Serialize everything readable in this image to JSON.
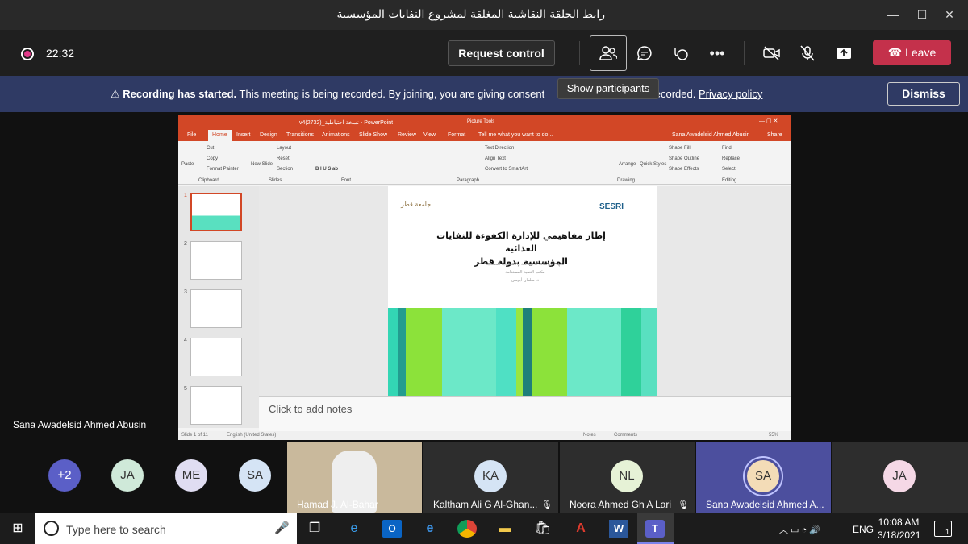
{
  "window": {
    "title": "رابط الحلقة النقاشية المغلقة لمشروع النفايات المؤسسية"
  },
  "topbar": {
    "timer": "22:32",
    "request_control": "Request control",
    "leave": "Leave"
  },
  "tooltip": "Show participants",
  "banner": {
    "bold": "Recording has started.",
    "text_a": " This meeting is being recorded. By joining, you are giving consent ",
    "text_b": " recorded. ",
    "link": "Privacy policy",
    "dismiss": "Dismiss"
  },
  "presenter_name": "Sana Awadelsid Ahmed Abusin",
  "ppt": {
    "titlebar": "v4(2732)_نسخة احتياطية - PowerPoint",
    "picture_tools": "Picture Tools",
    "user": "Sana Awadelsid Ahmed Abusin",
    "share": "Share",
    "tabs": [
      "File",
      "Home",
      "Insert",
      "Design",
      "Transitions",
      "Animations",
      "Slide Show",
      "Review",
      "View",
      "Format"
    ],
    "tell_me": "Tell me what you want to do...",
    "ribbon": {
      "cut": "Cut",
      "copy": "Copy",
      "format_painter": "Format Painter",
      "paste": "Paste",
      "clipboard": "Clipboard",
      "layout": "Layout",
      "reset": "Reset",
      "section": "Section",
      "new_slide": "New Slide",
      "slides": "Slides",
      "font": "Font",
      "paragraph": "Paragraph",
      "text_direction": "Text Direction",
      "align_text": "Align Text",
      "smartart": "Convert to SmartArt",
      "arrange": "Arrange",
      "quick_styles": "Quick Styles",
      "shape_fill": "Shape Fill",
      "shape_outline": "Shape Outline",
      "shape_effects": "Shape Effects",
      "drawing": "Drawing",
      "find": "Find",
      "replace": "Replace",
      "select": "Select",
      "editing": "Editing"
    },
    "slide_numbers": [
      "1",
      "2",
      "3",
      "4",
      "5"
    ],
    "slide": {
      "title_line1": "إطار مفاهيمي للإدارة الكفوءة للنفايات الغذائية",
      "title_line2": "المؤسسية بدولة قطر",
      "sub1": "معهد الدراسات الاجتماعية والاقتصادية المسحية",
      "sub2": "مكتب التنمية المستدامة",
      "sub3": "د. سلمان أبوسن",
      "logo_left": "جامعة قطر",
      "logo_right": "SESRI"
    },
    "notes": "Click to add notes",
    "status_left": "Slide 1 of 11",
    "status_lang": "English (United States)",
    "status_notes": "Notes",
    "status_comments": "Comments",
    "zoom": "55%"
  },
  "gallery": {
    "overflow": "+2",
    "avatars": [
      "JA",
      "ME",
      "SA"
    ],
    "tiles": [
      {
        "name": "Hamad J. Al-Bahar"
      },
      {
        "initials": "KA",
        "name": "Kaltham Ali G Al-Ghan..."
      },
      {
        "initials": "NL",
        "name": "Noora Ahmed Gh A Lari"
      },
      {
        "initials": "SA",
        "name": "Sana Awadelsid Ahmed A..."
      },
      {
        "initials": "JA"
      }
    ]
  },
  "taskbar": {
    "search": "Type here to search",
    "lang": "ENG",
    "time": "10:08 AM",
    "date": "3/18/2021",
    "notif": "1"
  }
}
